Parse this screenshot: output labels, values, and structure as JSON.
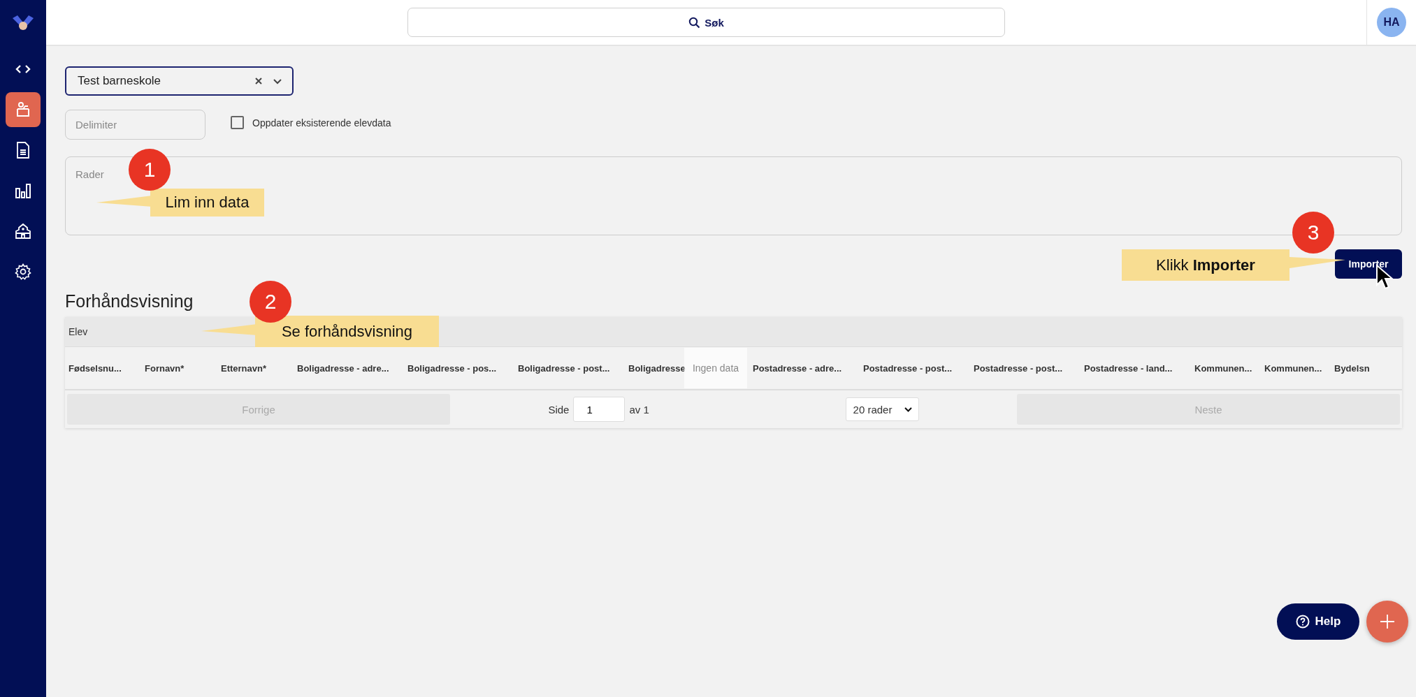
{
  "sidebar": {
    "items": [
      {
        "selected": false
      },
      {
        "selected": true
      },
      {
        "selected": false
      },
      {
        "selected": false
      },
      {
        "selected": false
      },
      {
        "selected": false
      }
    ]
  },
  "topbar": {
    "search": {
      "label": "Søk"
    },
    "avatar": {
      "initials": "HA"
    }
  },
  "form": {
    "school_select": {
      "value": "Test barneskole"
    },
    "delimiter": {
      "placeholder": "Delimiter"
    },
    "update_checkbox": {
      "label": "Oppdater eksisterende elevdata",
      "checked": false
    },
    "rows_field": {
      "placeholder": "Rader"
    },
    "import_button": "Importer"
  },
  "preview": {
    "title": "Forhåndsvisning",
    "group_header": "Elev",
    "columns": [
      "Fødselsnu...",
      "Fornavn*",
      "Etternavn*",
      "Boligadresse - adre...",
      "Boligadresse - pos...",
      "Boligadresse - post...",
      "Boligadresse",
      "Postadresse - adre...",
      "Postadresse - post...",
      "Postadresse - post...",
      "Postadresse - land...",
      "Kommunen...",
      "Kommunen...",
      "Bydelsn"
    ],
    "empty_message": "Ingen data",
    "pagination": {
      "previous": {
        "label": "Forrige",
        "disabled": true
      },
      "page_label": "Side",
      "page_value": "1",
      "page_total": "av 1",
      "page_size": "20 rader",
      "next": {
        "label": "Neste",
        "disabled": true
      }
    }
  },
  "callouts": [
    {
      "number": "1",
      "text": "Lim inn data"
    },
    {
      "number": "2",
      "text": "Se forhåndsvisning"
    },
    {
      "number": "3",
      "text": "Klikk **Importer**"
    }
  ],
  "help_button": "Help"
}
